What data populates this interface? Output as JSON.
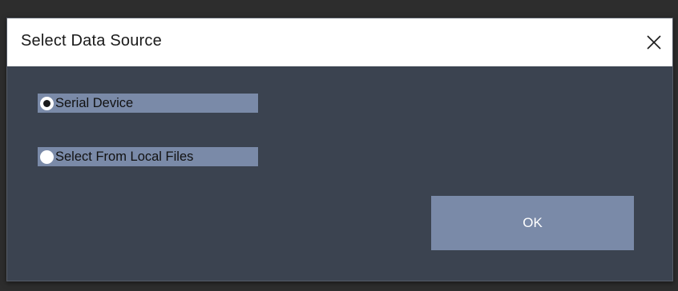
{
  "dialog": {
    "title": "Select Data Source",
    "close_icon": "close-icon"
  },
  "options": [
    {
      "label": "Serial Device",
      "checked": true
    },
    {
      "label": "Select From Local Files",
      "checked": false
    }
  ],
  "ok_button": {
    "label": "OK"
  },
  "colors": {
    "dialog_background": "#3b4350",
    "option_background": "#7a8aa8",
    "titlebar_background": "#ffffff"
  }
}
